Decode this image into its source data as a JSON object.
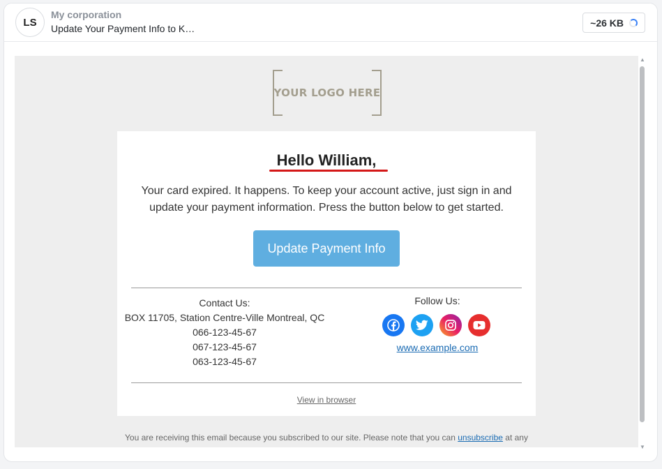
{
  "header": {
    "avatar_initials": "LS",
    "sender": "My corporation",
    "subject": "Update Your Payment Info to K…",
    "size": "~26 KB"
  },
  "email": {
    "logo_text": "YOUR LOGO HERE",
    "greeting": "Hello William,",
    "message": "Your card expired. It happens. To keep your account active, just sign in and update your payment information. Press the button below to get started.",
    "cta_label": "Update Payment Info",
    "contact": {
      "title": "Contact Us:",
      "address": "BOX 11705, Station Centre-Ville Montreal, QC",
      "phones": [
        "066-123-45-67",
        "067-123-45-67",
        "063-123-45-67"
      ]
    },
    "follow": {
      "title": "Follow Us:",
      "icons": [
        "facebook-icon",
        "twitter-icon",
        "instagram-icon",
        "youtube-icon"
      ],
      "website": "www.example.com"
    },
    "view_in_browser": "View in browser",
    "footer": {
      "text_before": "You are receiving this email because you subscribed to our site. Please note that you can ",
      "unsubscribe": "unsubscribe",
      "text_after": " at any"
    }
  },
  "colors": {
    "cta": "#5faee0",
    "underline": "#d41818",
    "link": "#1a6bb3",
    "facebook": "#1877f2",
    "twitter": "#1da1f2",
    "youtube": "#e62e2e"
  }
}
